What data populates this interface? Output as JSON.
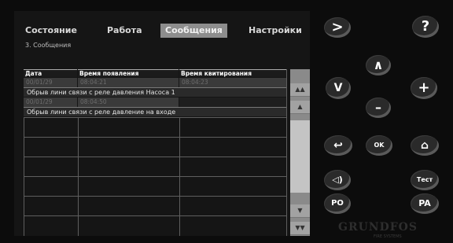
{
  "tabs": [
    {
      "label": "Состояние"
    },
    {
      "label": "Работа"
    },
    {
      "label": "Сообщения"
    },
    {
      "label": "Настройки"
    }
  ],
  "breadcrumb": "3. Сообщения",
  "table": {
    "headers": [
      "Дата",
      "Время появления",
      "Время квитирования"
    ],
    "rows": [
      {
        "date": "00/01/29",
        "appeared": "08:04:21",
        "acknowledged": "08:04:23",
        "message": "Обрыв лини связи с реле давления Насоса 1"
      },
      {
        "date": "00/01/29",
        "appeared": "08:04:50",
        "acknowledged": "",
        "message": "Обрыв лини связи с реле давление на входе"
      }
    ]
  },
  "scrollbar": {
    "up_fast": "▲▲",
    "up": "▲",
    "down": "▼",
    "down_fast": "▼▼"
  },
  "keypad": {
    "forward": ">",
    "help": "?",
    "up": "∧",
    "left": "V",
    "plus": "+",
    "minus": "–",
    "back": "↩",
    "ok": "OK",
    "home": "⌂",
    "sound": "◁)",
    "test": "Тест",
    "po": "PO",
    "pa": "PA"
  },
  "brand": {
    "name": "GRUNDFOS",
    "sub": "FIRE SYSTEMS"
  }
}
